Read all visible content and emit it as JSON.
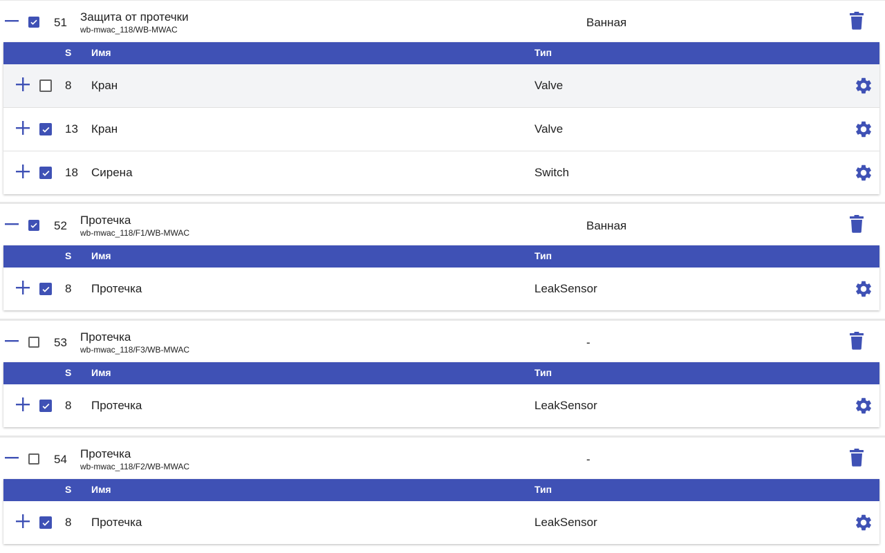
{
  "table_headers": {
    "s": "S",
    "name": "Имя",
    "type": "Тип"
  },
  "colors": {
    "accent": "#3f51b5",
    "header_text": "#ffffff"
  },
  "icons": {
    "collapse": "minus-icon",
    "expand": "plus-icon",
    "delete": "trash-icon",
    "settings": "gear-icon",
    "check": "check-icon"
  },
  "groups": [
    {
      "id": "51",
      "name": "Защита от протечки",
      "path": "wb-mwac_118/WB-MWAC",
      "room": "Ванная",
      "checked": true,
      "rows": [
        {
          "s": "8",
          "name": "Кран",
          "type": "Valve",
          "checked": false
        },
        {
          "s": "13",
          "name": "Кран",
          "type": "Valve",
          "checked": true
        },
        {
          "s": "18",
          "name": "Сирена",
          "type": "Switch",
          "checked": true
        }
      ]
    },
    {
      "id": "52",
      "name": "Протечка",
      "path": "wb-mwac_118/F1/WB-MWAC",
      "room": "Ванная",
      "checked": true,
      "rows": [
        {
          "s": "8",
          "name": "Протечка",
          "type": "LeakSensor",
          "checked": true
        }
      ]
    },
    {
      "id": "53",
      "name": "Протечка",
      "path": "wb-mwac_118/F3/WB-MWAC",
      "room": "-",
      "checked": false,
      "rows": [
        {
          "s": "8",
          "name": "Протечка",
          "type": "LeakSensor",
          "checked": true
        }
      ]
    },
    {
      "id": "54",
      "name": "Протечка",
      "path": "wb-mwac_118/F2/WB-MWAC",
      "room": "-",
      "checked": false,
      "rows": [
        {
          "s": "8",
          "name": "Протечка",
          "type": "LeakSensor",
          "checked": true
        }
      ]
    }
  ]
}
